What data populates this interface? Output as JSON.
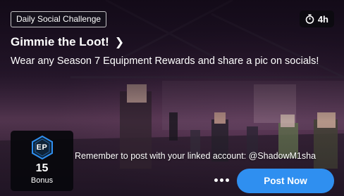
{
  "card": {
    "tag": "Daily Social Challenge",
    "timer": {
      "icon": "stopwatch-icon",
      "value": "4h"
    },
    "title": "Gimmie the Loot!",
    "title_icon": "chevron-right-icon",
    "description": "Wear any Season 7 Equipment Rewards and share a pic on socials!",
    "reward": {
      "icon": "ep-badge-icon",
      "badge_text": "EP",
      "amount": "15",
      "label": "Bonus"
    },
    "note": "Remember to post with your linked account: @ShadowM1sha",
    "more_icon": "more-dots-icon",
    "post_button": "Post Now"
  },
  "colors": {
    "accent": "#2f8ff0",
    "badge": "#2f8ff0",
    "tag_bg": "#14141c"
  }
}
